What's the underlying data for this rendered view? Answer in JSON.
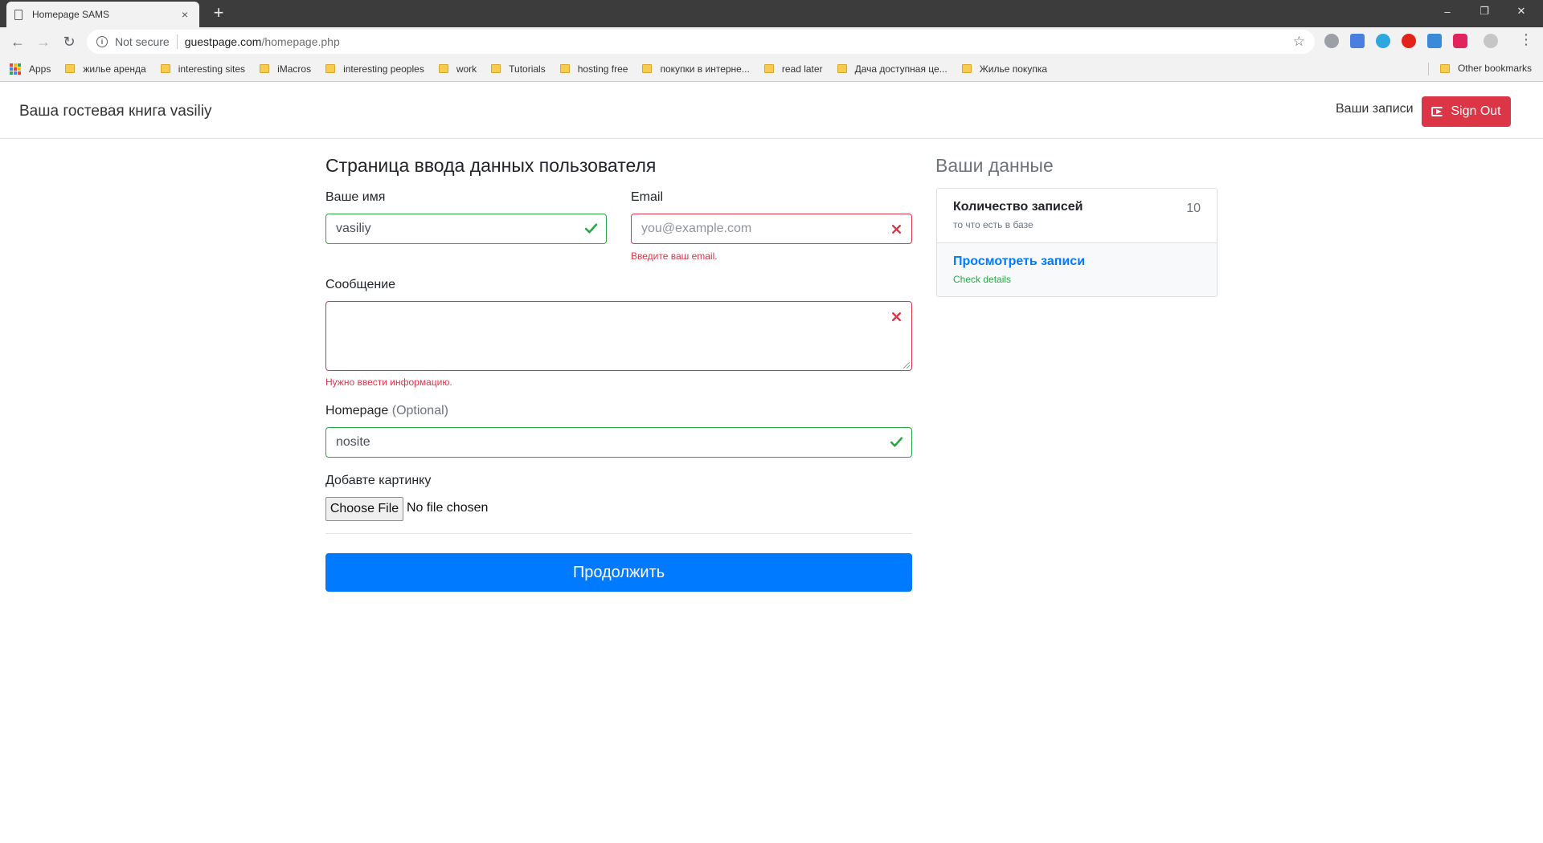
{
  "browser": {
    "tab_title": "Homepage SAMS",
    "close_glyph": "×",
    "new_tab_glyph": "+",
    "window_controls": {
      "minimize": "–",
      "maximize": "❐",
      "close": "✕"
    },
    "nav": {
      "back": "←",
      "forward": "→",
      "reload": "↻"
    },
    "address": {
      "security_label": "Not secure",
      "host": "guestpage.com",
      "path": "/homepage.php"
    },
    "bookmarks": [
      {
        "label": "Apps",
        "icon": "apps-grid-icon"
      },
      {
        "label": "жилье аренда",
        "icon": "folder-icon"
      },
      {
        "label": "interesting sites",
        "icon": "folder-icon"
      },
      {
        "label": "iMacros",
        "icon": "folder-icon"
      },
      {
        "label": "interesting peoples",
        "icon": "folder-icon"
      },
      {
        "label": "work",
        "icon": "folder-icon"
      },
      {
        "label": "Tutorials",
        "icon": "folder-icon"
      },
      {
        "label": "hosting free",
        "icon": "folder-icon"
      },
      {
        "label": "покупки в интерне...",
        "icon": "folder-icon"
      },
      {
        "label": "read later",
        "icon": "folder-icon"
      },
      {
        "label": "Дача доступная це...",
        "icon": "folder-icon"
      },
      {
        "label": "Жилье покупка",
        "icon": "folder-icon"
      }
    ],
    "other_bookmarks": "Other bookmarks"
  },
  "navbar": {
    "brand": "Ваша гостевая книга vasiliy",
    "records_link": "Ваши записи",
    "sign_out": "Sign Out"
  },
  "form": {
    "title": "Страница ввода данных пользователя",
    "name": {
      "label": "Ваше имя",
      "value": "vasiliy",
      "state": "valid"
    },
    "email": {
      "label": "Email",
      "placeholder": "you@example.com",
      "error": "Введите ваш email.",
      "state": "invalid"
    },
    "message": {
      "label": "Сообщение",
      "value": "",
      "error": "Нужно ввести информацию.",
      "state": "invalid"
    },
    "homepage": {
      "label": "Homepage",
      "optional": "(Optional)",
      "value": "nosite",
      "state": "valid"
    },
    "picture": {
      "label": "Добавте картинку",
      "button": "Choose File",
      "status": "No file chosen"
    },
    "submit": "Продолжить"
  },
  "sidebar": {
    "title": "Ваши данные",
    "count_item": {
      "title": "Количество записей",
      "subtitle": "то что есть в базе",
      "count": "10"
    },
    "view_item": {
      "title": "Просмотреть записи",
      "subtitle": "Check details"
    }
  },
  "colors": {
    "primary": "#007bff",
    "success": "#28a745",
    "danger": "#dc3545",
    "muted": "#6c757d"
  }
}
